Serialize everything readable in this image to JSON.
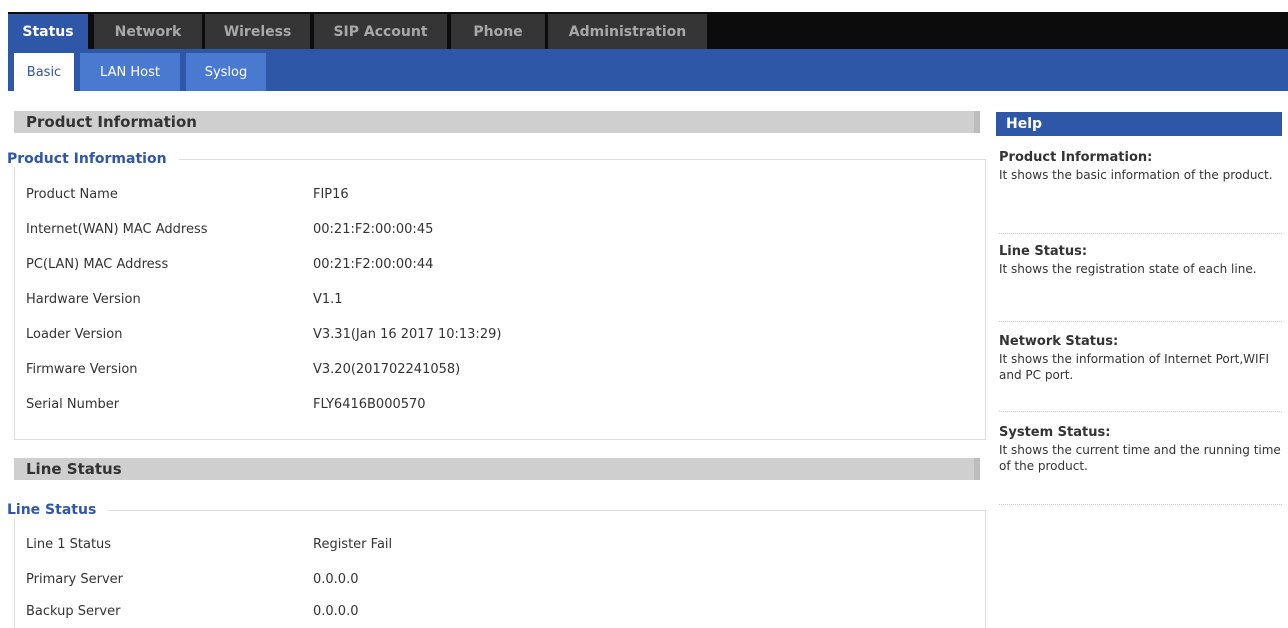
{
  "top_tabs": [
    {
      "label": "Status",
      "active": true
    },
    {
      "label": "Network",
      "active": false
    },
    {
      "label": "Wireless",
      "active": false
    },
    {
      "label": "SIP Account",
      "active": false
    },
    {
      "label": "Phone",
      "active": false
    },
    {
      "label": "Administration",
      "active": false
    }
  ],
  "sub_tabs": [
    {
      "label": "Basic",
      "active": true
    },
    {
      "label": "LAN Host",
      "active": false
    },
    {
      "label": "Syslog",
      "active": false
    }
  ],
  "product_section": {
    "header": "Product Information",
    "legend": "Product Information",
    "rows": [
      {
        "label": "Product Name",
        "value": "FIP16"
      },
      {
        "label": "Internet(WAN) MAC Address",
        "value": "00:21:F2:00:00:45"
      },
      {
        "label": "PC(LAN) MAC Address",
        "value": "00:21:F2:00:00:44"
      },
      {
        "label": "Hardware Version",
        "value": "V1.1"
      },
      {
        "label": "Loader Version",
        "value": "V3.31(Jan 16 2017 10:13:29)"
      },
      {
        "label": "Firmware Version",
        "value": "V3.20(201702241058)"
      },
      {
        "label": "Serial Number",
        "value": "FLY6416B000570"
      }
    ]
  },
  "line_section": {
    "header": "Line Status",
    "legend": "Line Status",
    "rows": [
      {
        "label": "Line 1 Status",
        "value": "Register Fail"
      },
      {
        "label": "Primary Server",
        "value": "0.0.0.0"
      },
      {
        "label": "Backup Server",
        "value": "0.0.0.0"
      }
    ]
  },
  "help": {
    "header": "Help",
    "items": [
      {
        "title": "Product Information:",
        "text": "It shows the basic information of the product."
      },
      {
        "title": "Line Status:",
        "text": "It shows the registration state of each line."
      },
      {
        "title": "Network Status:",
        "text": "It shows the information of Internet Port,WIFI and PC port."
      },
      {
        "title": "System Status:",
        "text": "It shows the current time and the running time of the product."
      }
    ]
  },
  "colors": {
    "nav_active": "#2f57a8",
    "nav_inactive": "#353535",
    "sub_inactive": "#4a7ad0",
    "legend_text": "#2f57a8",
    "section_bar": "#cfcfcf"
  }
}
